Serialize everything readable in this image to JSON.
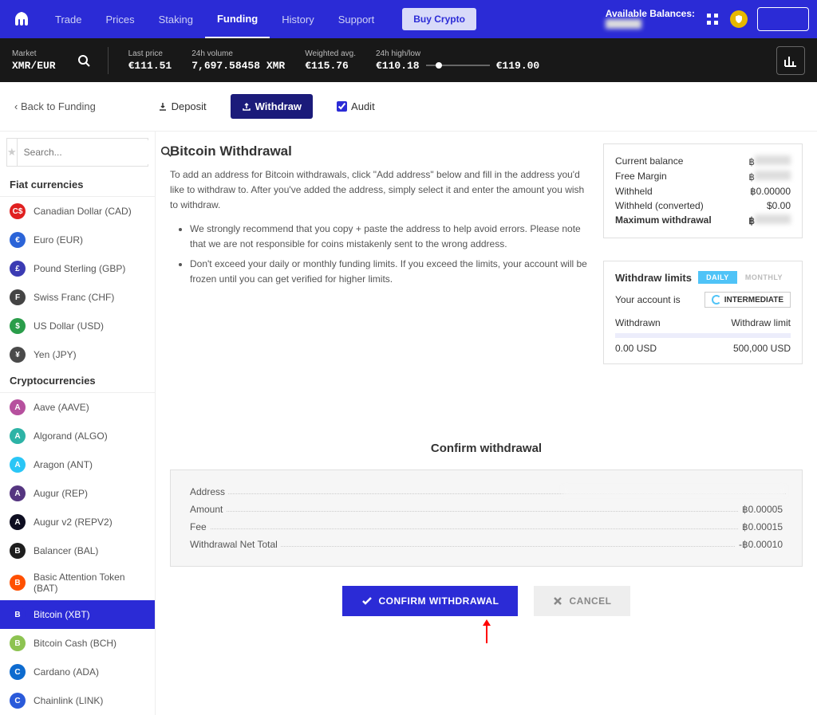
{
  "nav": {
    "items": [
      "Trade",
      "Prices",
      "Staking",
      "Funding",
      "History",
      "Support"
    ],
    "active": "Funding",
    "buy_crypto": "Buy Crypto",
    "avail_bal": "Available Balances:"
  },
  "market": {
    "label": "Market",
    "pair": "XMR/EUR",
    "last_price_label": "Last price",
    "last_price": "€111.51",
    "vol_label": "24h volume",
    "vol": "7,697.58458 XMR",
    "wavg_label": "Weighted avg.",
    "wavg": "€115.76",
    "range_label": "24h high/low",
    "low": "€110.18",
    "high": "€119.00"
  },
  "tabs": {
    "back": "‹ Back to Funding",
    "deposit": "Deposit",
    "withdraw": "Withdraw",
    "audit": "Audit"
  },
  "search": {
    "placeholder": "Search..."
  },
  "fiat_hdr": "Fiat currencies",
  "crypto_hdr": "Cryptocurrencies",
  "fiat": [
    {
      "name": "Canadian Dollar",
      "code": "CAD",
      "sym": "C$",
      "color": "#e02020"
    },
    {
      "name": "Euro",
      "code": "EUR",
      "sym": "€",
      "color": "#2b64d8"
    },
    {
      "name": "Pound Sterling",
      "code": "GBP",
      "sym": "£",
      "color": "#3b3bb3"
    },
    {
      "name": "Swiss Franc",
      "code": "CHF",
      "sym": "F",
      "color": "#444"
    },
    {
      "name": "US Dollar",
      "code": "USD",
      "sym": "$",
      "color": "#2a9d4a"
    },
    {
      "name": "Yen",
      "code": "JPY",
      "sym": "¥",
      "color": "#4a4a4a"
    }
  ],
  "crypto": [
    {
      "name": "Aave",
      "code": "AAVE",
      "color": "#b6509e"
    },
    {
      "name": "Algorand",
      "code": "ALGO",
      "color": "#2db3a6"
    },
    {
      "name": "Aragon",
      "code": "ANT",
      "color": "#2ac6f6"
    },
    {
      "name": "Augur",
      "code": "REP",
      "color": "#553580"
    },
    {
      "name": "Augur v2",
      "code": "REPV2",
      "color": "#0e0e21"
    },
    {
      "name": "Balancer",
      "code": "BAL",
      "color": "#1e1e1e"
    },
    {
      "name": "Basic Attention Token",
      "code": "BAT",
      "color": "#ff5000"
    },
    {
      "name": "Bitcoin",
      "code": "XBT",
      "color": "#2b2bd6",
      "active": true
    },
    {
      "name": "Bitcoin Cash",
      "code": "BCH",
      "color": "#8dc351"
    },
    {
      "name": "Cardano",
      "code": "ADA",
      "color": "#0d6bcf"
    },
    {
      "name": "Chainlink",
      "code": "LINK",
      "color": "#2a5ada"
    }
  ],
  "page": {
    "title": "Bitcoin Withdrawal",
    "desc": "To add an address for Bitcoin withdrawals, click \"Add address\" below and fill in the address you'd like to withdraw to. After you've added the address, simply select it and enter the amount you wish to withdraw.",
    "bullet1": "We strongly recommend that you copy + paste the address to help avoid errors. Please note that we are not responsible for coins mistakenly sent to the wrong address.",
    "bullet2": "Don't exceed your daily or monthly funding limits. If you exceed the limits, your account will be frozen until you can get verified for higher limits."
  },
  "balance": {
    "curr_label": "Current balance",
    "curr_val": "฿",
    "free_label": "Free Margin",
    "free_val": "฿",
    "wh_label": "Withheld",
    "wh_val": "฿0.00000",
    "whc_label": "Withheld (converted)",
    "whc_val": "$0.00",
    "max_label": "Maximum withdrawal",
    "max_val": "฿"
  },
  "limits": {
    "title": "Withdraw limits",
    "daily": "DAILY",
    "monthly": "MONTHLY",
    "acct_is": "Your account is",
    "tier": "INTERMEDIATE",
    "withdrawn_label": "Withdrawn",
    "limit_label": "Withdraw limit",
    "withdrawn": "0.00 USD",
    "limit_val": "500,000 USD"
  },
  "confirm": {
    "title": "Confirm withdrawal",
    "address_label": "Address",
    "amount_label": "Amount",
    "amount_val": "฿0.00005",
    "fee_label": "Fee",
    "fee_val": "฿0.00015",
    "net_label": "Withdrawal Net Total",
    "net_val": "-฿0.00010",
    "confirm_btn": "CONFIRM WITHDRAWAL",
    "cancel_btn": "CANCEL"
  }
}
